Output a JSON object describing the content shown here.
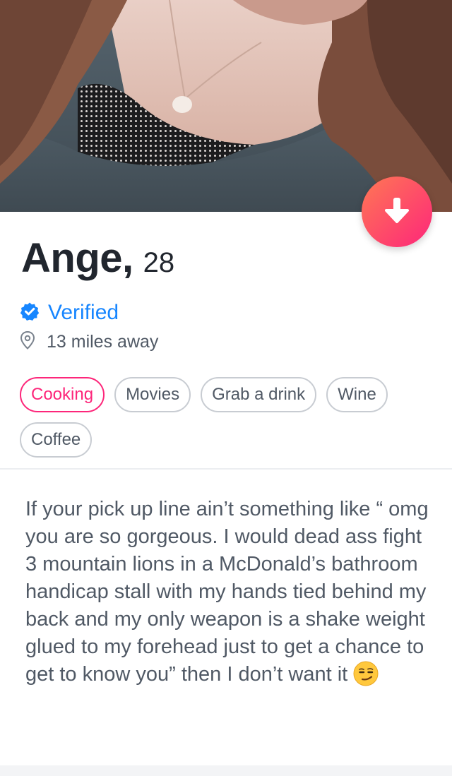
{
  "profile": {
    "name": "Ange,",
    "age": "28",
    "verified_label": "Verified",
    "distance": "13 miles away",
    "interests": [
      "Cooking",
      "Movies",
      "Grab a drink",
      "Wine",
      "Coffee"
    ],
    "active_interest": "Cooking",
    "bio": "If your pick up line ain’t something like “ omg you are so gorgeous. I would dead ass fight 3 mountain lions in a McDonald’s bathroom handicap stall with my hands tied behind my back and my only weapon is a shake weight glued to my forehead just to get a chance to get to know you” then I don’t want it"
  },
  "icons": {
    "collapse": "arrow-down-icon",
    "verified": "verified-check-icon",
    "location": "location-pin-icon",
    "emoji": "smirking-face-emoji"
  },
  "colors": {
    "brand_start": "#ff7854",
    "brand_end": "#fd267a",
    "verified_blue": "#1786ff",
    "text_dark": "#21262e",
    "text_muted": "#505965"
  }
}
